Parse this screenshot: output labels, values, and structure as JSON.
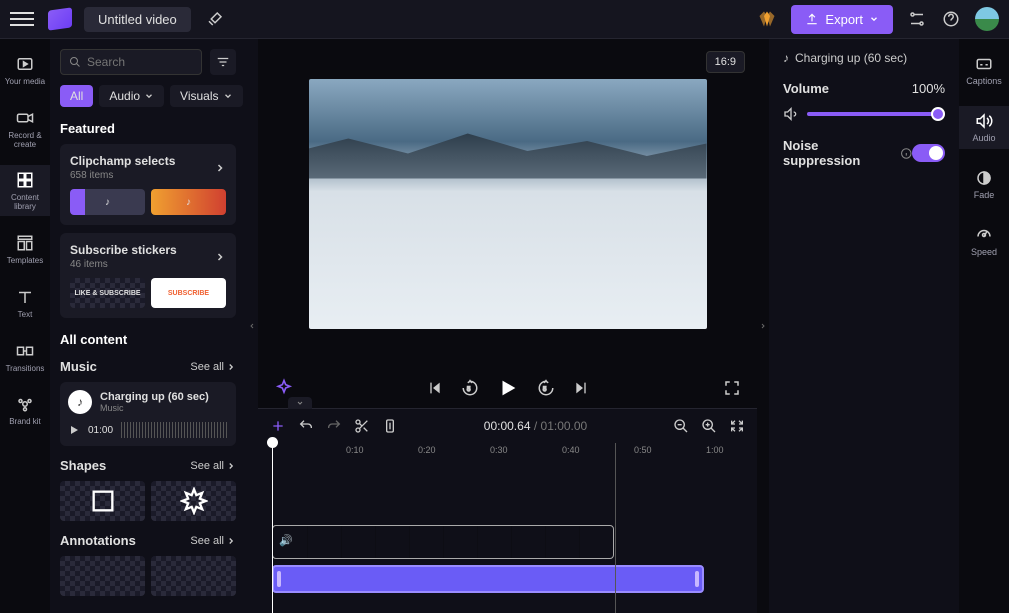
{
  "topbar": {
    "title": "Untitled video",
    "export_label": "Export"
  },
  "left_rail": {
    "your_media": "Your media",
    "record_create": "Record & create",
    "content_library": "Content library",
    "templates": "Templates",
    "text": "Text",
    "transitions": "Transitions",
    "brand_kit": "Brand kit"
  },
  "library": {
    "search_placeholder": "Search",
    "tabs": {
      "all": "All",
      "audio": "Audio",
      "visuals": "Visuals"
    },
    "featured_title": "Featured",
    "clipchamp_selects": {
      "title": "Clipchamp selects",
      "subtitle": "658 items"
    },
    "subscribe_stickers": {
      "title": "Subscribe stickers",
      "subtitle": "46 items",
      "thumb1": "LIKE & SUBSCRIBE",
      "thumb2": "SUBSCRIBE"
    },
    "all_content_title": "All content",
    "music_title": "Music",
    "see_all": "See all",
    "music_item": {
      "title": "Charging up (60 sec)",
      "subtitle": "Music",
      "duration": "01:00"
    },
    "shapes_title": "Shapes",
    "annotations_title": "Annotations"
  },
  "preview": {
    "aspect_ratio": "16:9"
  },
  "timeline": {
    "current_time": "00:00.64",
    "duration": "01:00.00",
    "ticks": [
      "0:10",
      "0:20",
      "0:30",
      "0:40",
      "0:50",
      "1:00"
    ]
  },
  "properties": {
    "clip_name": "Charging up (60 sec)",
    "volume_label": "Volume",
    "volume_value": "100%",
    "noise_label": "Noise suppression"
  },
  "right_rail": {
    "captions": "Captions",
    "audio": "Audio",
    "fade": "Fade",
    "speed": "Speed"
  }
}
